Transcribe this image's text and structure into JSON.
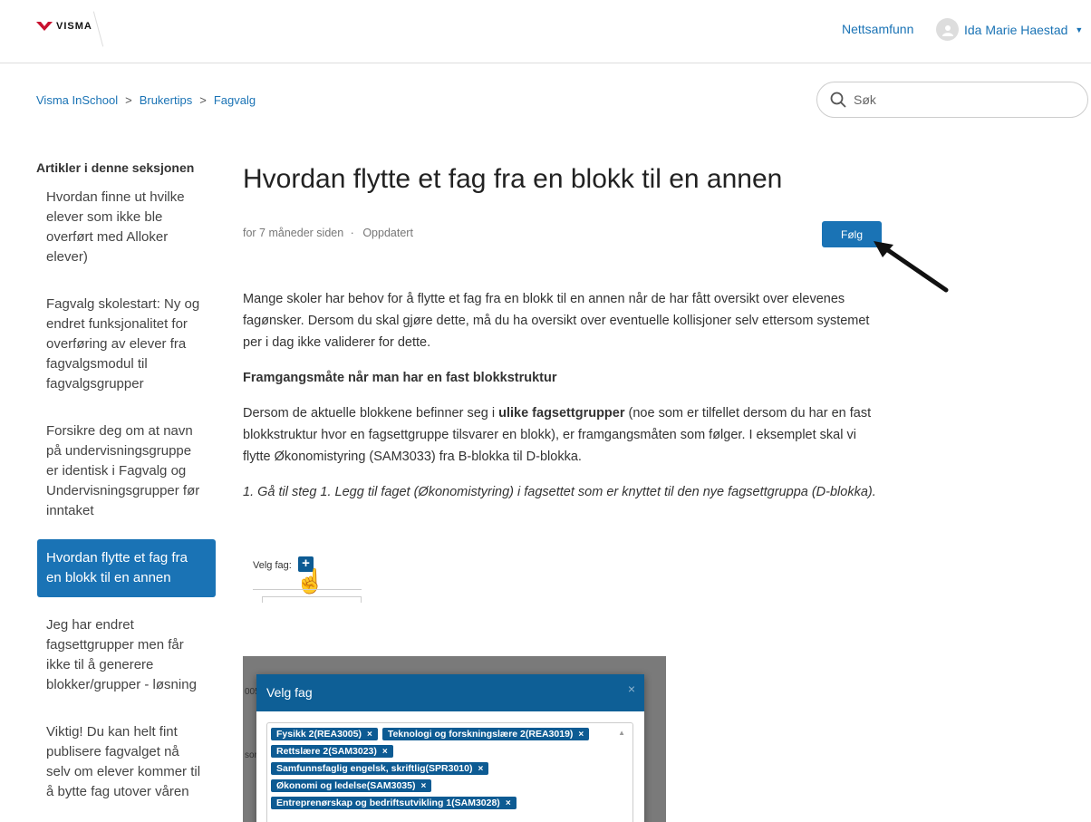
{
  "header": {
    "brand": "VISMA",
    "nav_link": "Nettsamfunn",
    "user_name": "Ida Marie Haestad"
  },
  "breadcrumb": [
    "Visma InSchool",
    "Brukertips",
    "Fagvalg"
  ],
  "search": {
    "placeholder": "Søk"
  },
  "sidebar": {
    "title": "Artikler i denne seksjonen",
    "items": [
      "Hvordan finne ut hvilke elever som ikke ble overført med Alloker elever)",
      "Fagvalg skolestart: Ny og endret funksjonalitet for overføring av elever fra fagvalgsmodul til fagvalgsgrupper",
      "Forsikre deg om at navn på undervisningsgruppe er identisk i Fagvalg og Undervisningsgrupper før inntaket",
      "Hvordan flytte et fag fra en blokk til en annen",
      "Jeg har endret fagsettgrupper men får ikke til å generere blokker/grupper - løsning",
      "Viktig! Du kan helt fint publisere fagvalget nå selv om elever kommer til å bytte fag utover våren"
    ],
    "active_index": 3
  },
  "article": {
    "title": "Hvordan flytte et fag fra en blokk til en annen",
    "meta_time": "for 7 måneder siden",
    "meta_sep": "·",
    "meta_updated": "Oppdatert",
    "follow_label": "Følg",
    "p1": "Mange skoler har behov for å flytte et fag fra en blokk til en annen når de har fått oversikt over elevenes fagønsker. Dersom du skal gjøre dette, må du ha oversikt over eventuelle kollisjoner selv ettersom systemet per i dag ikke validerer for dette.",
    "h2": "Framgangsmåte når man har en fast blokkstruktur",
    "p2_before": "Dersom de aktuelle blokkene befinner seg i ",
    "p2_bold": "ulike fagsettgrupper",
    "p2_after": " (noe som er tilfellet dersom du har en fast blokkstruktur hvor en fagsettgruppe tilsvarer en blokk), er framgangsmåten som følger. I eksemplet skal vi flytte Økonomistyring (SAM3033) fra B-blokka til D-blokka.",
    "p3": "1. Gå til steg 1. Legg til faget (Økonomistyring) i fagsettet som er knyttet til den nye fagsettgruppa (D-blokka)."
  },
  "screenshot1": {
    "label": "Velg fag:"
  },
  "screenshot2": {
    "bg_texts": [
      "005",
      "sor"
    ],
    "modal_title": "Velg fag",
    "chips": [
      [
        "Fysikk 2(REA3005)",
        "Teknologi og forskningslære 2(REA3019)"
      ],
      [
        "Rettslære 2(SAM3023)"
      ],
      [
        "Samfunnsfaglig engelsk, skriftlig(SPR3010)"
      ],
      [
        "Økonomi og ledelse(SAM3035)"
      ],
      [
        "Entreprenørskap og bedriftsutvikling 1(SAM3028)"
      ]
    ],
    "chip_remove": "×",
    "close_glyph": "×"
  },
  "colors": {
    "accent": "#1a73b5",
    "modal_header": "#0e5f96",
    "chip": "#0d5b93"
  }
}
